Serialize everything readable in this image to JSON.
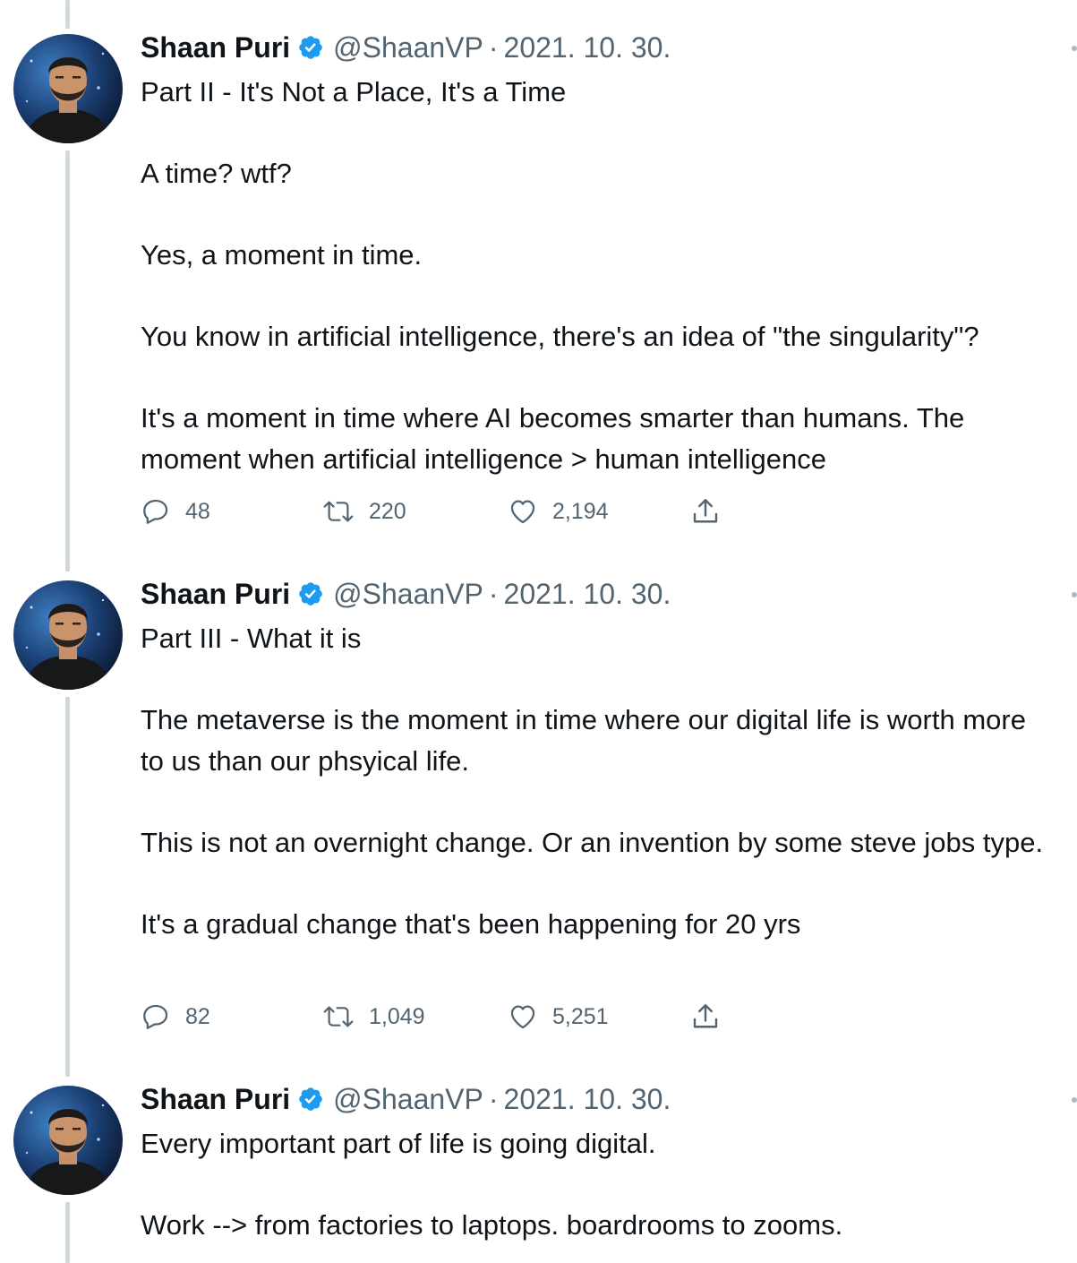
{
  "tweets": [
    {
      "author_name": "Shaan Puri",
      "handle": "@ShaanVP",
      "separator": "·",
      "date": "2021. 10. 30.",
      "paragraphs": [
        "Part II - It's Not a Place, It's a Time",
        "A time? wtf?",
        "Yes, a moment in time.",
        "You know in artificial intelligence, there's an idea of \"the singularity\"?",
        "It's a moment in time where AI becomes smarter than humans. The moment when artificial intelligence > human intelligence"
      ],
      "replies": "48",
      "retweets": "220",
      "likes": "2,194"
    },
    {
      "author_name": "Shaan Puri",
      "handle": "@ShaanVP",
      "separator": "·",
      "date": "2021. 10. 30.",
      "paragraphs": [
        "Part III - What it is",
        "The metaverse is the moment in time where our digital life is worth more to us than our phsyical life.",
        "This is not an overnight change. Or an invention by some steve jobs type.",
        "It's a gradual change that's been happening for 20 yrs"
      ],
      "replies": "82",
      "retweets": "1,049",
      "likes": "5,251"
    },
    {
      "author_name": "Shaan Puri",
      "handle": "@ShaanVP",
      "separator": "·",
      "date": "2021. 10. 30.",
      "paragraphs": [
        "Every important part of life is going digital.",
        "Work --> from factories to laptops. boardrooms to zooms."
      ]
    }
  ],
  "icons": {
    "verified": "verified-badge-icon",
    "reply": "reply-icon",
    "retweet": "retweet-icon",
    "like": "heart-icon",
    "share": "share-icon"
  },
  "colors": {
    "verified_blue": "#1d9bf0",
    "text": "#0f1419",
    "secondary_text": "#536471",
    "thread_line": "#cfd9de"
  }
}
